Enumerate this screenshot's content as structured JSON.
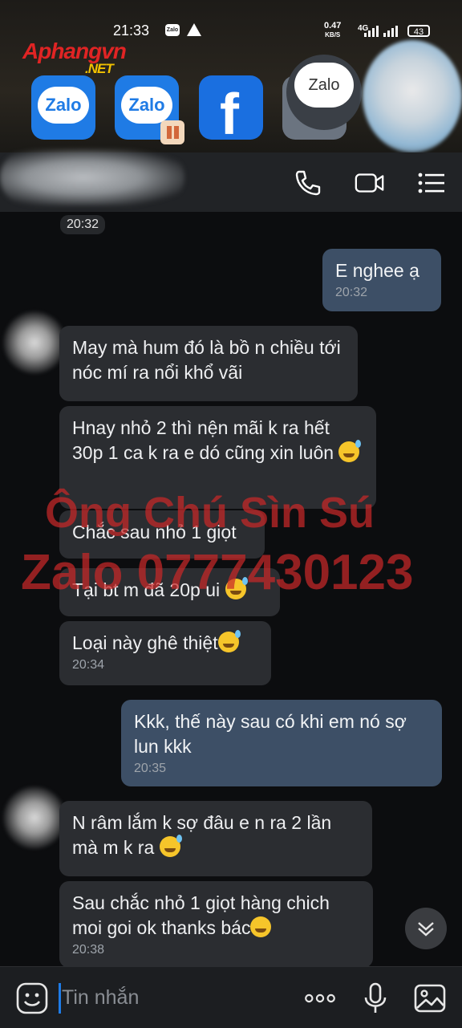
{
  "status_bar": {
    "time": "21:33",
    "speed_value": "0.47",
    "speed_unit": "KB/S",
    "network": "4G",
    "battery": "43"
  },
  "watermark_logo": {
    "main": "Aphangvn",
    "sub": ".NET"
  },
  "app_icons": [
    {
      "name": "zalo-app-icon",
      "label": "Zalo"
    },
    {
      "name": "zalo-clone-app-icon",
      "label": "Zalo"
    },
    {
      "name": "facebook-app-icon",
      "label": "f"
    }
  ],
  "floating_bubble": {
    "label": "Zalo"
  },
  "chat": {
    "day_time": "20:32",
    "messages": [
      {
        "side": "right",
        "text": "E  nghee ạ",
        "time": "20:32"
      },
      {
        "side": "left",
        "text": "May mà hum đó là bồ n chiều tới nóc mí ra nổi khổ vãi",
        "time": ""
      },
      {
        "side": "left",
        "text": "Hnay nhỏ 2 thì nện mãi k ra hết 30p 1 ca k ra e dó cũng xin luôn",
        "time": ""
      },
      {
        "side": "left",
        "text": "Chắc sau nhỏ 1 giọt",
        "time": ""
      },
      {
        "side": "left",
        "text": "Tại bt m đã 20p ui",
        "time": ""
      },
      {
        "side": "left",
        "text": "Loại này ghê thiệt",
        "time": "20:34"
      },
      {
        "side": "right",
        "text": "Kkk, thế này sau có khi em nó sợ lun kkk",
        "time": "20:35"
      },
      {
        "side": "left",
        "text": "N râm lắm k sợ đâu e n ra 2 lần mà m k ra",
        "time": ""
      },
      {
        "side": "left",
        "text": "Sau chắc nhỏ 1 giọt hàng chich moi goi ok thanks bác",
        "time": "20:38"
      }
    ]
  },
  "overlay_watermark": {
    "line1": "Ông Chú Sìn Sú",
    "line2": "Zalo 0777430123"
  },
  "input": {
    "placeholder": "Tin nhắn"
  },
  "colors": {
    "bubble_out": "#3d4f66",
    "bubble_in": "#2b2d31",
    "accent": "#1e7ce8",
    "watermark": "#c82828"
  }
}
